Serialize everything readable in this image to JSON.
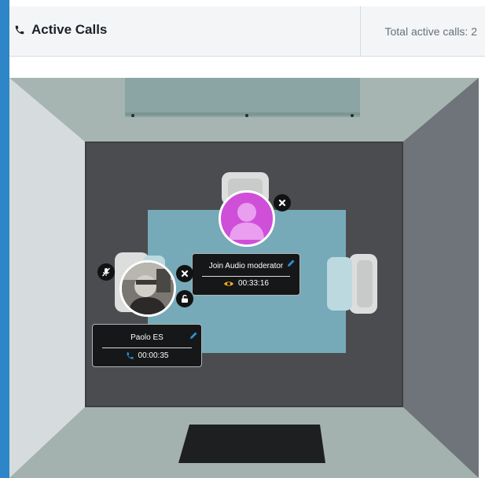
{
  "header": {
    "title": "Active Calls",
    "total_label": "Total active calls: 2",
    "phone_icon": "phone-icon"
  },
  "participants": [
    {
      "name": "Join Audio moderator",
      "duration": "00:33:16",
      "status_icon": "eye-icon",
      "status_color": "#f0a81a",
      "avatar": "generic-user-avatar",
      "avatar_color": "#cf4fd9",
      "actions": [
        "close-icon",
        "pencil-icon"
      ]
    },
    {
      "name": "Paolo ES",
      "duration": "00:00:35",
      "status_icon": "phone-icon",
      "status_color": "#2f8fd6",
      "avatar": "photo-avatar",
      "actions": [
        "mic-muted-icon",
        "close-icon",
        "unlock-icon",
        "pencil-icon"
      ]
    }
  ],
  "colors": {
    "accent": "#2e86c8",
    "table": "#76aab8",
    "carpet": "#4a4b4f"
  }
}
